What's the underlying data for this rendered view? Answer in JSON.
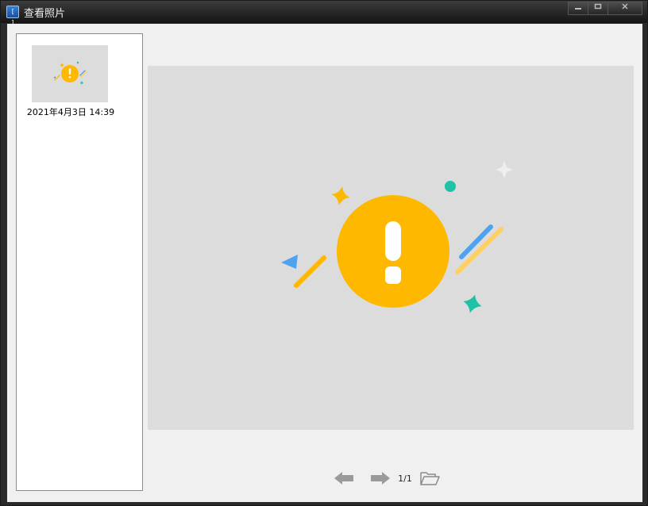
{
  "window": {
    "title": "查看照片",
    "app_icon_text": "[ ]"
  },
  "thumbnails": [
    {
      "caption": "2021年4月3日 14:39",
      "selected": true
    }
  ],
  "navigation": {
    "page_indicator": "1/1"
  },
  "colors": {
    "accent_yellow": "#FFB800",
    "accent_teal": "#1EC2A6",
    "accent_blue": "#4DA3F0",
    "preview_bg": "#DCDCDC"
  },
  "icons": [
    "app-icon",
    "minimize-icon",
    "maximize-icon",
    "close-icon",
    "arrow-left-icon",
    "arrow-right-icon",
    "folder-open-icon",
    "warning-illustration"
  ]
}
